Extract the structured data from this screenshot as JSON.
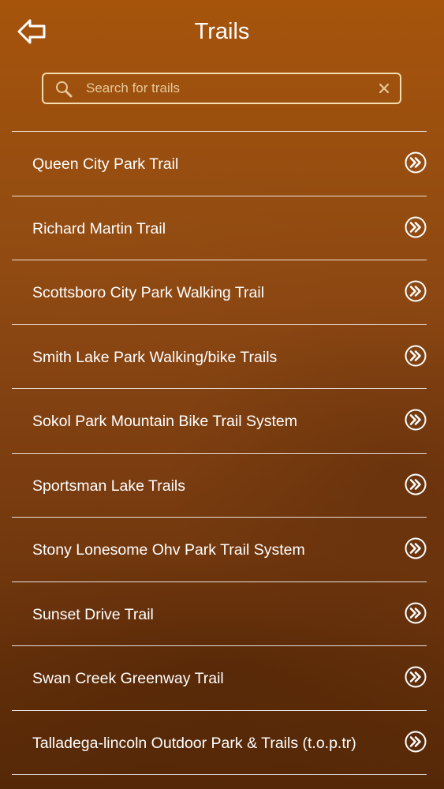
{
  "header": {
    "title": "Trails",
    "back_icon": "back-arrow-icon"
  },
  "search": {
    "placeholder": "Search for trails",
    "value": "",
    "search_icon": "search-icon",
    "clear_icon": "clear-icon"
  },
  "trails": [
    {
      "name": "Queen City Park Trail",
      "icon": "double-chevron-right-icon"
    },
    {
      "name": "Richard Martin Trail",
      "icon": "double-chevron-right-icon"
    },
    {
      "name": "Scottsboro City Park Walking Trail",
      "icon": "double-chevron-right-icon"
    },
    {
      "name": "Smith Lake Park Walking/bike Trails",
      "icon": "double-chevron-right-icon"
    },
    {
      "name": "Sokol Park Mountain Bike Trail System",
      "icon": "double-chevron-right-icon"
    },
    {
      "name": "Sportsman Lake Trails",
      "icon": "double-chevron-right-icon"
    },
    {
      "name": "Stony Lonesome Ohv Park Trail System",
      "icon": "double-chevron-right-icon"
    },
    {
      "name": "Sunset Drive Trail",
      "icon": "double-chevron-right-icon"
    },
    {
      "name": "Swan Creek Greenway Trail",
      "icon": "double-chevron-right-icon"
    },
    {
      "name": "Talladega-lincoln Outdoor Park & Trails (t.o.p.tr)",
      "icon": "double-chevron-right-icon"
    }
  ],
  "colors": {
    "background_top": "#a6540c",
    "background_bottom": "#552807",
    "search_border": "#f3dcae",
    "text": "#ffffff"
  }
}
